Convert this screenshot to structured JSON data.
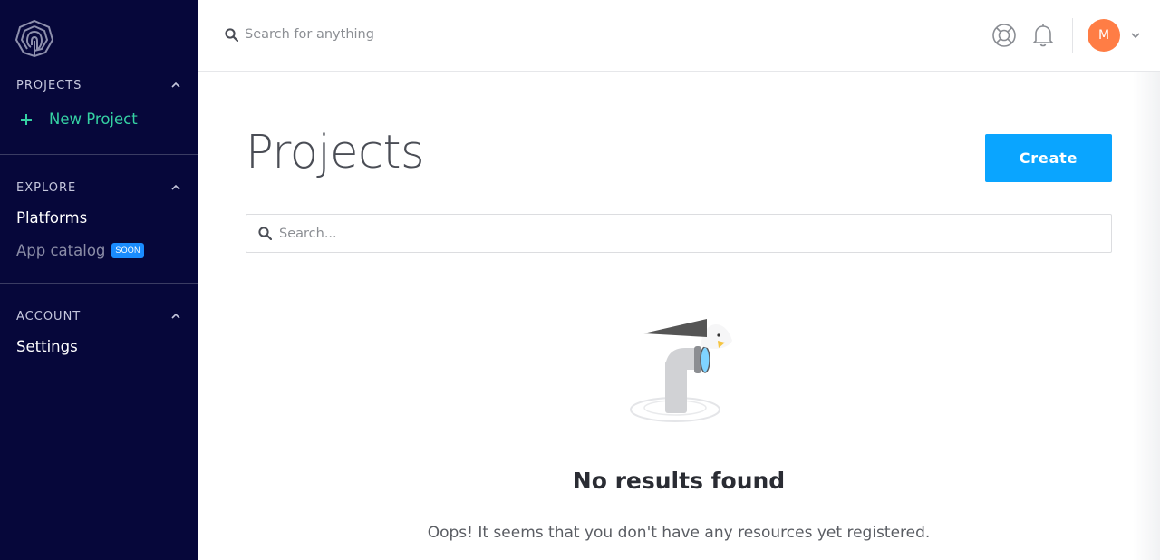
{
  "sidebar": {
    "logo_icon": "fingerprint-logo-icon",
    "sections": {
      "projects": {
        "title": "PROJECTS",
        "items": [
          {
            "label": "New Project",
            "icon": "plus-icon"
          }
        ]
      },
      "explore": {
        "title": "EXPLORE",
        "items": [
          {
            "label": "Platforms"
          },
          {
            "label": "App catalog",
            "badge": "SOON"
          }
        ]
      },
      "account": {
        "title": "ACCOUNT",
        "items": [
          {
            "label": "Settings"
          }
        ]
      }
    }
  },
  "topbar": {
    "search_placeholder": "Search for anything",
    "avatar_initial": "M"
  },
  "main": {
    "title": "Projects",
    "create_label": "Create",
    "search_placeholder": "Search...",
    "empty_title": "No results found",
    "empty_subtitle": "Oops! It seems that you don't have any resources yet registered."
  },
  "colors": {
    "sidebar_bg": "#06073a",
    "accent_green": "#35d1a3",
    "primary_blue": "#0aa5ff",
    "avatar_orange": "#ff7d45"
  }
}
